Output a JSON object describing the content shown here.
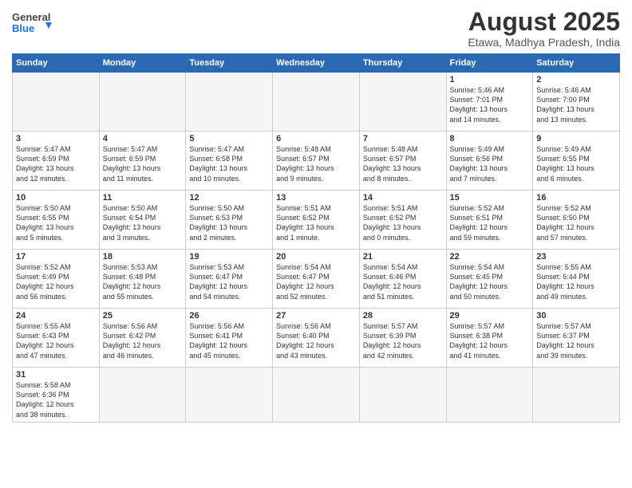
{
  "header": {
    "logo_general": "General",
    "logo_blue": "Blue",
    "title": "August 2025",
    "subtitle": "Etawa, Madhya Pradesh, India"
  },
  "days_of_week": [
    "Sunday",
    "Monday",
    "Tuesday",
    "Wednesday",
    "Thursday",
    "Friday",
    "Saturday"
  ],
  "weeks": [
    [
      {
        "day": "",
        "info": ""
      },
      {
        "day": "",
        "info": ""
      },
      {
        "day": "",
        "info": ""
      },
      {
        "day": "",
        "info": ""
      },
      {
        "day": "",
        "info": ""
      },
      {
        "day": "1",
        "info": "Sunrise: 5:46 AM\nSunset: 7:01 PM\nDaylight: 13 hours\nand 14 minutes."
      },
      {
        "day": "2",
        "info": "Sunrise: 5:46 AM\nSunset: 7:00 PM\nDaylight: 13 hours\nand 13 minutes."
      }
    ],
    [
      {
        "day": "3",
        "info": "Sunrise: 5:47 AM\nSunset: 6:59 PM\nDaylight: 13 hours\nand 12 minutes."
      },
      {
        "day": "4",
        "info": "Sunrise: 5:47 AM\nSunset: 6:59 PM\nDaylight: 13 hours\nand 11 minutes."
      },
      {
        "day": "5",
        "info": "Sunrise: 5:47 AM\nSunset: 6:58 PM\nDaylight: 13 hours\nand 10 minutes."
      },
      {
        "day": "6",
        "info": "Sunrise: 5:48 AM\nSunset: 6:57 PM\nDaylight: 13 hours\nand 9 minutes."
      },
      {
        "day": "7",
        "info": "Sunrise: 5:48 AM\nSunset: 6:57 PM\nDaylight: 13 hours\nand 8 minutes."
      },
      {
        "day": "8",
        "info": "Sunrise: 5:49 AM\nSunset: 6:56 PM\nDaylight: 13 hours\nand 7 minutes."
      },
      {
        "day": "9",
        "info": "Sunrise: 5:49 AM\nSunset: 6:55 PM\nDaylight: 13 hours\nand 6 minutes."
      }
    ],
    [
      {
        "day": "10",
        "info": "Sunrise: 5:50 AM\nSunset: 6:55 PM\nDaylight: 13 hours\nand 5 minutes."
      },
      {
        "day": "11",
        "info": "Sunrise: 5:50 AM\nSunset: 6:54 PM\nDaylight: 13 hours\nand 3 minutes."
      },
      {
        "day": "12",
        "info": "Sunrise: 5:50 AM\nSunset: 6:53 PM\nDaylight: 13 hours\nand 2 minutes."
      },
      {
        "day": "13",
        "info": "Sunrise: 5:51 AM\nSunset: 6:52 PM\nDaylight: 13 hours\nand 1 minute."
      },
      {
        "day": "14",
        "info": "Sunrise: 5:51 AM\nSunset: 6:52 PM\nDaylight: 13 hours\nand 0 minutes."
      },
      {
        "day": "15",
        "info": "Sunrise: 5:52 AM\nSunset: 6:51 PM\nDaylight: 12 hours\nand 59 minutes."
      },
      {
        "day": "16",
        "info": "Sunrise: 5:52 AM\nSunset: 6:50 PM\nDaylight: 12 hours\nand 57 minutes."
      }
    ],
    [
      {
        "day": "17",
        "info": "Sunrise: 5:52 AM\nSunset: 6:49 PM\nDaylight: 12 hours\nand 56 minutes."
      },
      {
        "day": "18",
        "info": "Sunrise: 5:53 AM\nSunset: 6:48 PM\nDaylight: 12 hours\nand 55 minutes."
      },
      {
        "day": "19",
        "info": "Sunrise: 5:53 AM\nSunset: 6:47 PM\nDaylight: 12 hours\nand 54 minutes."
      },
      {
        "day": "20",
        "info": "Sunrise: 5:54 AM\nSunset: 6:47 PM\nDaylight: 12 hours\nand 52 minutes."
      },
      {
        "day": "21",
        "info": "Sunrise: 5:54 AM\nSunset: 6:46 PM\nDaylight: 12 hours\nand 51 minutes."
      },
      {
        "day": "22",
        "info": "Sunrise: 5:54 AM\nSunset: 6:45 PM\nDaylight: 12 hours\nand 50 minutes."
      },
      {
        "day": "23",
        "info": "Sunrise: 5:55 AM\nSunset: 6:44 PM\nDaylight: 12 hours\nand 49 minutes."
      }
    ],
    [
      {
        "day": "24",
        "info": "Sunrise: 5:55 AM\nSunset: 6:43 PM\nDaylight: 12 hours\nand 47 minutes."
      },
      {
        "day": "25",
        "info": "Sunrise: 5:56 AM\nSunset: 6:42 PM\nDaylight: 12 hours\nand 46 minutes."
      },
      {
        "day": "26",
        "info": "Sunrise: 5:56 AM\nSunset: 6:41 PM\nDaylight: 12 hours\nand 45 minutes."
      },
      {
        "day": "27",
        "info": "Sunrise: 5:56 AM\nSunset: 6:40 PM\nDaylight: 12 hours\nand 43 minutes."
      },
      {
        "day": "28",
        "info": "Sunrise: 5:57 AM\nSunset: 6:39 PM\nDaylight: 12 hours\nand 42 minutes."
      },
      {
        "day": "29",
        "info": "Sunrise: 5:57 AM\nSunset: 6:38 PM\nDaylight: 12 hours\nand 41 minutes."
      },
      {
        "day": "30",
        "info": "Sunrise: 5:57 AM\nSunset: 6:37 PM\nDaylight: 12 hours\nand 39 minutes."
      }
    ],
    [
      {
        "day": "31",
        "info": "Sunrise: 5:58 AM\nSunset: 6:36 PM\nDaylight: 12 hours\nand 38 minutes."
      },
      {
        "day": "",
        "info": ""
      },
      {
        "day": "",
        "info": ""
      },
      {
        "day": "",
        "info": ""
      },
      {
        "day": "",
        "info": ""
      },
      {
        "day": "",
        "info": ""
      },
      {
        "day": "",
        "info": ""
      }
    ]
  ]
}
